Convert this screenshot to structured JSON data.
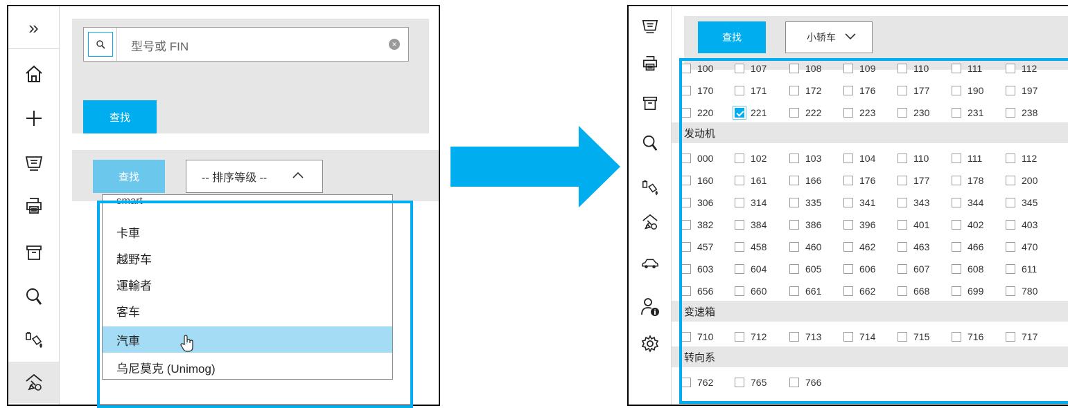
{
  "left_panel": {
    "search": {
      "placeholder": "型号或 FIN",
      "button_label": "查找",
      "clear_label": "×"
    },
    "filter": {
      "button_label": "查找",
      "sort_select": {
        "value": "-- 排序等级 --"
      }
    },
    "dropdown": {
      "items": [
        "smart",
        "卡車",
        "越野车",
        "運輸者",
        "客车",
        "汽車",
        "乌尼莫克 (Unimog)"
      ],
      "highlighted": "汽車"
    },
    "sidebar_icons": [
      "expand-icon",
      "home-icon",
      "plus-icon",
      "cart-icon",
      "print-icon",
      "archive-icon",
      "search-icon",
      "paint-bucket-icon",
      "workshop-tools-icon"
    ],
    "expand_glyph": "»"
  },
  "right_panel": {
    "search_button_label": "查找",
    "vehicle_select": {
      "value": "小轿车"
    },
    "sidebar_icons": [
      "cart-icon",
      "print-icon",
      "archive-icon",
      "search-icon",
      "paint-bucket-icon",
      "workshop-tools-icon",
      "car-icon",
      "user-info-icon",
      "settings-icon"
    ],
    "rows_top": [
      [
        "100",
        "107",
        "108",
        "109",
        "110",
        "111",
        "112"
      ],
      [
        "170",
        "171",
        "172",
        "176",
        "177",
        "190",
        "197"
      ],
      [
        "220",
        "221",
        "222",
        "223",
        "230",
        "231",
        "238"
      ]
    ],
    "checked_values": [
      "221"
    ],
    "sections": [
      {
        "title": "发动机",
        "rows": [
          [
            "000",
            "102",
            "103",
            "104",
            "110",
            "111",
            "112"
          ],
          [
            "160",
            "161",
            "166",
            "176",
            "177",
            "178",
            "200"
          ],
          [
            "306",
            "314",
            "335",
            "341",
            "343",
            "344",
            "345"
          ],
          [
            "382",
            "384",
            "386",
            "396",
            "401",
            "402",
            "403"
          ],
          [
            "457",
            "458",
            "460",
            "462",
            "463",
            "466",
            "470"
          ],
          [
            "603",
            "604",
            "605",
            "606",
            "607",
            "608",
            "611"
          ],
          [
            "656",
            "660",
            "661",
            "662",
            "668",
            "699",
            "780"
          ]
        ]
      },
      {
        "title": "变速箱",
        "rows": [
          [
            "710",
            "712",
            "713",
            "714",
            "715",
            "716",
            "717"
          ]
        ]
      },
      {
        "title": "转向系",
        "rows": [
          [
            "762",
            "765",
            "766"
          ]
        ]
      }
    ]
  },
  "colors": {
    "accent": "#00adef",
    "accent_light": "#6cc7ec",
    "highlight": "#a5dcf5",
    "panel_bg": "#e6e6e6"
  }
}
